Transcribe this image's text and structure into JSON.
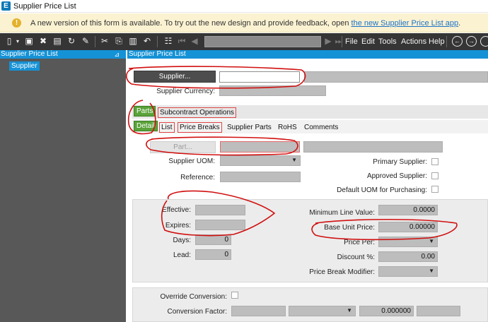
{
  "window": {
    "title": "Supplier Price List",
    "app_icon": "E"
  },
  "banner": {
    "message": "A new version of this form is available. To try out the new design and provide feedback, open ",
    "link": "the new Supplier Price List app",
    "end": "."
  },
  "toolbar": {
    "menus": [
      "File",
      "Edit",
      "Tools",
      "Actions",
      "Help"
    ]
  },
  "tree": {
    "header": "Supplier Price List",
    "pin": "⊿",
    "node": "Supplier"
  },
  "main": {
    "header": "Supplier Price List",
    "supplier_button": "Supplier...",
    "supplier_value": "",
    "supplier_currency_label": "Supplier Currency:",
    "tabs_row1": {
      "active": "Parts",
      "other": "Subcontract Operations"
    },
    "tabs_row2": {
      "active": "Detail",
      "items": [
        "List",
        "Price Breaks",
        "Supplier Parts",
        "RoHS",
        "Comments"
      ]
    },
    "part_button": "Part...",
    "supplier_uom_label": "Supplier UOM:",
    "reference_label": "Reference:",
    "primary_supplier_label": "Primary Supplier:",
    "approved_supplier_label": "Approved Supplier:",
    "default_uom_label": "Default UOM for Purchasing:",
    "effective_label": "Effective:",
    "expires_label": "Expires:",
    "days_label": "Days:",
    "days_value": "0",
    "lead_label": "Lead:",
    "lead_value": "0",
    "min_line_value_label": "Minimum Line Value:",
    "min_line_value": "0.0000",
    "base_unit_price_label": "Base Unit Price:",
    "base_unit_price": "0.00000",
    "price_per_label": "Price Per:",
    "discount_label": "Discount %:",
    "discount_value": "0.00",
    "price_break_modifier_label": "Price Break Modifier:",
    "override_conversion_label": "Override Conversion:",
    "conversion_factor_label": "Conversion Factor:",
    "conversion_factor_value": "0.000000"
  },
  "colors": {
    "accent": "#1592d6",
    "toolbar": "#353535",
    "tab_green": "#5aa23a",
    "annotation": "#d10f0f"
  }
}
